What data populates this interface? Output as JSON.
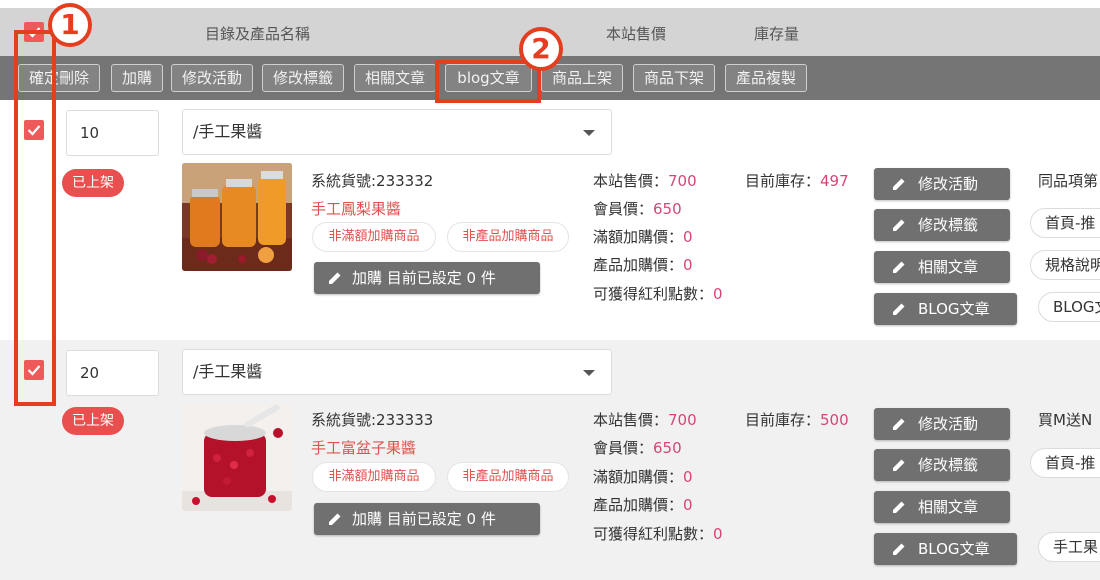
{
  "header": {
    "col_name": "目錄及產品名稱",
    "col_price": "本站售價",
    "col_stock": "庫存量"
  },
  "toolbar": {
    "buttons": [
      "確定刪除",
      "加購",
      "修改活動",
      "修改標籤",
      "相關文章",
      "blog文章",
      "商品上架",
      "商品下架",
      "產品複製"
    ]
  },
  "annotations": {
    "badge1": "1",
    "badge2": "2"
  },
  "actions": {
    "edit_event": "修改活動",
    "edit_tags": "修改標籤",
    "related": "相關文章",
    "blog": "BLOG文章"
  },
  "products": [
    {
      "checked": true,
      "sort": "10",
      "category": "/手工果醬",
      "status": "已上架",
      "sku": "系統貨號:233332",
      "name": "手工鳳梨果醬",
      "tag1": "非滿額加購商品",
      "tag2": "非產品加購商品",
      "add_label": "加購 目前已設定 0 件",
      "price_label": "本站售價：",
      "price": "700",
      "member_label": "會員價：",
      "member": "650",
      "full_label": "滿額加購價：",
      "full": "0",
      "prod_label": "產品加購價：",
      "prod": "0",
      "points_label": "可獲得紅利點數：",
      "points": "0",
      "stock_label": "目前庫存：",
      "stock": "497",
      "right_text": "同品項第",
      "right_pills": [
        "首頁-推",
        "規格說明",
        "BLOG文"
      ]
    },
    {
      "checked": true,
      "sort": "20",
      "category": "/手工果醬",
      "status": "已上架",
      "sku": "系統貨號:233333",
      "name": "手工富盆子果醬",
      "tag1": "非滿額加購商品",
      "tag2": "非產品加購商品",
      "add_label": "加購 目前已設定 0 件",
      "price_label": "本站售價：",
      "price": "700",
      "member_label": "會員價：",
      "member": "650",
      "full_label": "滿額加購價：",
      "full": "0",
      "prod_label": "產品加購價：",
      "prod": "0",
      "points_label": "可獲得紅利點數：",
      "points": "0",
      "stock_label": "目前庫存：",
      "stock": "500",
      "right_text": "買M送N",
      "right_pills": [
        "首頁-推",
        "手工果"
      ]
    }
  ]
}
